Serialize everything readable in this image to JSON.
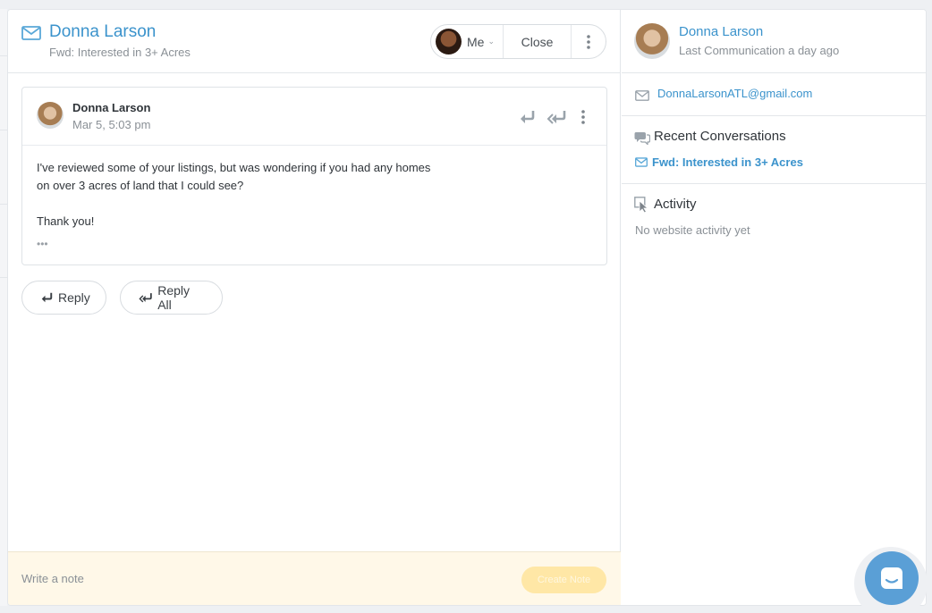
{
  "header": {
    "title": "Donna Larson",
    "subtitle": "Fwd: Interested in 3+ Acres",
    "assign_label": "Me",
    "close_label": "Close"
  },
  "email": {
    "sender": "Donna Larson",
    "date": "Mar 5, 5:03 pm",
    "body_lines": [
      "I've reviewed some of your listings, but was wondering if you had any homes",
      "on over 3 acres of land that I could see?",
      "Thank you!"
    ],
    "more": "•••"
  },
  "actions": {
    "reply_label": "Reply",
    "reply_all_label": "Reply All"
  },
  "note": {
    "placeholder": "Write a note",
    "button_label": "Create Note"
  },
  "contact": {
    "name": "Donna Larson",
    "last_communication": "Last Communication a day ago",
    "email": "DonnaLarsonATL@gmail.com"
  },
  "recent_conversations": {
    "title": "Recent Conversations",
    "items": [
      {
        "label": "Fwd: Interested in 3+ Acres"
      }
    ]
  },
  "activity": {
    "title": "Activity",
    "empty_text": "No website activity yet"
  },
  "colors": {
    "accent": "#3b93cc",
    "note_bg": "#fff8e8",
    "chat": "#5a9fd6"
  },
  "icons": {
    "header": "mail-icon",
    "reply": "reply-icon",
    "reply_all": "reply-all-icon",
    "more": "more-vertical-icon",
    "conversations": "chat-bubbles-icon",
    "activity": "cursor-click-icon",
    "chat": "chat-launcher-icon"
  }
}
